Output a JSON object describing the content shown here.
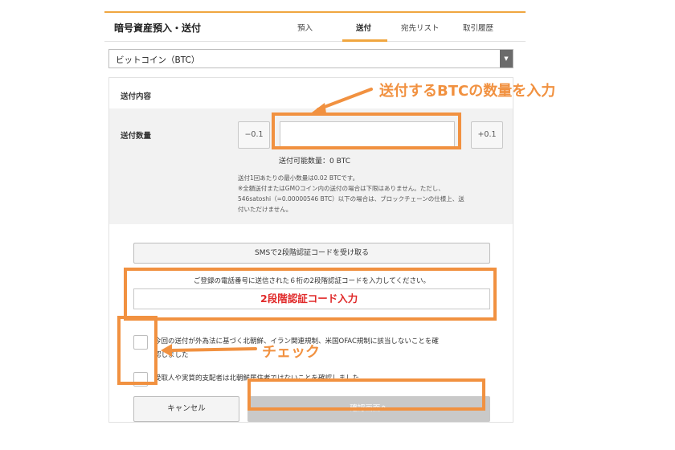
{
  "header": {
    "title": "暗号資産預入・送付",
    "tabs": [
      {
        "label": "預入"
      },
      {
        "label": "送付"
      },
      {
        "label": "宛先リスト"
      },
      {
        "label": "取引履歴"
      }
    ],
    "active_tab": "送付"
  },
  "currency_select": {
    "selected": "ビットコイン（BTC）"
  },
  "form": {
    "section_title": "送付内容",
    "amount_label": "送付数量",
    "minus_label": "−0.1",
    "plus_label": "+0.1",
    "available": "送付可能数量：0 BTC",
    "note_lines": [
      "送付1回あたりの最小数量は0.02 BTCです。",
      "※全額送付またはGMOコイン内の送付の場合は下限はありません。ただし、",
      "546satoshi（=0.00000546 BTC）以下の場合は、ブロックチェーンの仕様上、送",
      "付いただけません。"
    ],
    "sms_button": "SMSで2段階認証コードを受け取る",
    "code_instruction": "ご登録の電話番号に送信された６桁の2段階認証コードを入力してください。",
    "checkbox_1_line1": "今回の送付が外為法に基づく北朝鮮、イラン関連規制、米国OFAC規制に該当しないことを確",
    "checkbox_1_line2": "認しました",
    "checkbox_2": "受取人や実質的支配者は北朝鮮居住者ではないことを確認しました",
    "cancel_button": "キャンセル",
    "confirm_button": "確認画面へ"
  },
  "annotations": {
    "amount_note": "送付するBTCの数量を入力",
    "code_note": "2段階認証コード入力",
    "check_note": "チェック"
  },
  "colors": {
    "accent": "#f0a640",
    "annotation": "#f19140",
    "annotation_red": "#e02a2a",
    "disabled_button": "#c9c9c9"
  }
}
